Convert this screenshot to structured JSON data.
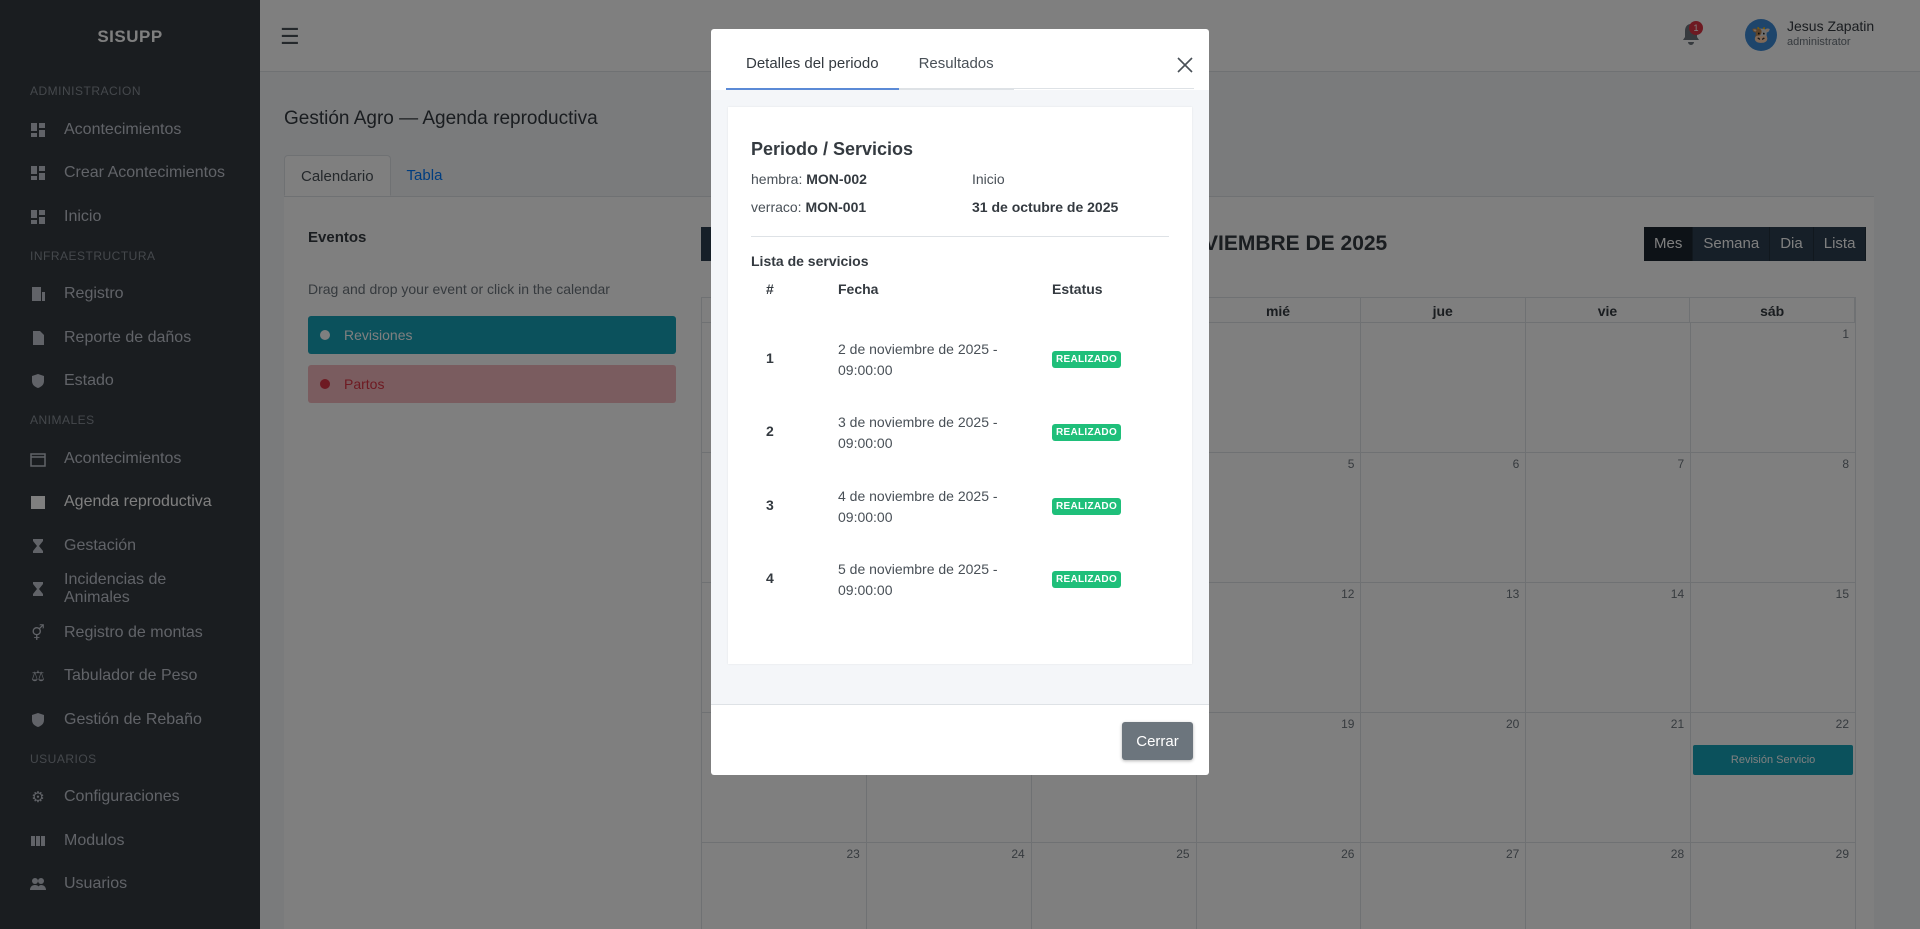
{
  "sidebar": {
    "brand": "SISUPP",
    "sections": [
      {
        "label": "ADMINISTRACION",
        "items": [
          {
            "label": "Acontecimientos",
            "icon": "dashboard-icon"
          },
          {
            "label": "Crear Acontecimientos",
            "icon": "dashboard-icon"
          },
          {
            "label": "Inicio",
            "icon": "dashboard-icon"
          }
        ]
      },
      {
        "label": "INFRAESTRUCTURA",
        "items": [
          {
            "label": "Registro",
            "icon": "building-icon"
          },
          {
            "label": "Reporte de daños",
            "icon": "file-icon"
          },
          {
            "label": "Estado",
            "icon": "shield-check-icon"
          }
        ]
      },
      {
        "label": "ANIMALES",
        "items": [
          {
            "label": "Acontecimientos",
            "icon": "calendar-icon"
          },
          {
            "label": "Agenda reproductiva",
            "icon": "calendar-check-icon"
          },
          {
            "label": "Gestación",
            "icon": "hourglass-icon"
          },
          {
            "label": "Incidencias de Animales",
            "icon": "hourglass-icon"
          },
          {
            "label": "Registro de montas",
            "icon": "venus-mars-icon"
          },
          {
            "label": "Tabulador de Peso",
            "icon": "scale-icon"
          },
          {
            "label": "Gestión de Rebaño",
            "icon": "shield-icon"
          }
        ]
      },
      {
        "label": "USUARIOS",
        "items": [
          {
            "label": "Configuraciones",
            "icon": "gear-icon"
          },
          {
            "label": "Modulos",
            "icon": "columns-icon"
          },
          {
            "label": "Usuarios",
            "icon": "users-icon"
          }
        ]
      }
    ]
  },
  "topbar": {
    "notification_count": "1",
    "user_name": "Jesus Zapatin",
    "user_role": "administrator"
  },
  "page": {
    "title": "Gestión Agro — Agenda reproductiva",
    "tabs": [
      "Calendario",
      "Tabla"
    ]
  },
  "events_panel": {
    "title": "Eventos",
    "hint": "Drag and drop your event or click in the calendar",
    "items": [
      "Revisiones",
      "Partos"
    ]
  },
  "calendar": {
    "title": "VIEMBRE DE 2025",
    "views": [
      "Mes",
      "Semana",
      "Dia",
      "Lista"
    ],
    "weekdays": [
      "",
      "",
      "",
      "mié",
      "jue",
      "vie",
      "sáb"
    ],
    "weeks": [
      [
        "",
        "",
        "",
        "",
        "",
        "",
        "1"
      ],
      [
        "",
        "",
        "",
        "5",
        "6",
        "7",
        "8"
      ],
      [
        "",
        "",
        "",
        "12",
        "13",
        "14",
        "15"
      ],
      [
        "",
        "",
        "",
        "19",
        "20",
        "21",
        "22"
      ],
      [
        "23",
        "24",
        "25",
        "26",
        "27",
        "28",
        "29"
      ]
    ],
    "event_label": "Revisión Servicio"
  },
  "modal": {
    "tabs": [
      "Detalles del periodo",
      "Resultados"
    ],
    "section_title": "Periodo / Servicios",
    "hembra_label": "hembra:",
    "hembra_value": "MON-002",
    "verraco_label": "verraco:",
    "verraco_value": "MON-001",
    "inicio_label": "Inicio",
    "inicio_value": "31 de octubre de 2025",
    "list_title": "Lista de servicios",
    "columns": [
      "#",
      "Fecha",
      "Estatus"
    ],
    "rows": [
      {
        "num": "1",
        "date_line1": "2 de noviembre de 2025 -",
        "date_line2": "09:00:00",
        "status": "REALIZADO"
      },
      {
        "num": "2",
        "date_line1": "3 de noviembre de 2025 -",
        "date_line2": "09:00:00",
        "status": "REALIZADO"
      },
      {
        "num": "3",
        "date_line1": "4 de noviembre de 2025 -",
        "date_line2": "09:00:00",
        "status": "REALIZADO"
      },
      {
        "num": "4",
        "date_line1": "5 de noviembre de 2025 -",
        "date_line2": "09:00:00",
        "status": "REALIZADO"
      }
    ],
    "close_label": "Cerrar"
  },
  "colors": {
    "sidebar_bg": "#343a40",
    "accent": "#17a2b8",
    "danger": "#dc3545",
    "badge": "#1fbf7a"
  }
}
